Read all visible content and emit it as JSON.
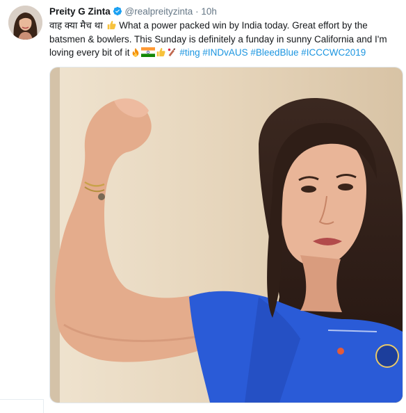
{
  "tweet": {
    "author_name": "Preity G Zinta",
    "handle": "@realpreityzinta",
    "separator": "·",
    "time": "10h",
    "line1_hindi": "वाह क्या मैच था",
    "line1_text": " What a power packed win by India  today. Great effort by the",
    "line2_text": "batsmen & bowlers. This Sunday is definitely a funday in sunny California and I'm",
    "line3_text": "loving every bit of it",
    "hashtags": [
      "#ting",
      "#INDvAUS",
      "#BleedBlue",
      "#ICCCWC2019"
    ]
  },
  "icons": {
    "verified": "verified-badge-icon",
    "thumbs_up": "thumbs-up-emoji",
    "fire": "fire-emoji",
    "india_flag": "india-flag-emoji",
    "cricket": "cricket-bat-emoji"
  },
  "colors": {
    "link": "#1b95e0",
    "meta": "#657786",
    "verified": "#1da1f2",
    "jersey": "#2a5bd7"
  }
}
